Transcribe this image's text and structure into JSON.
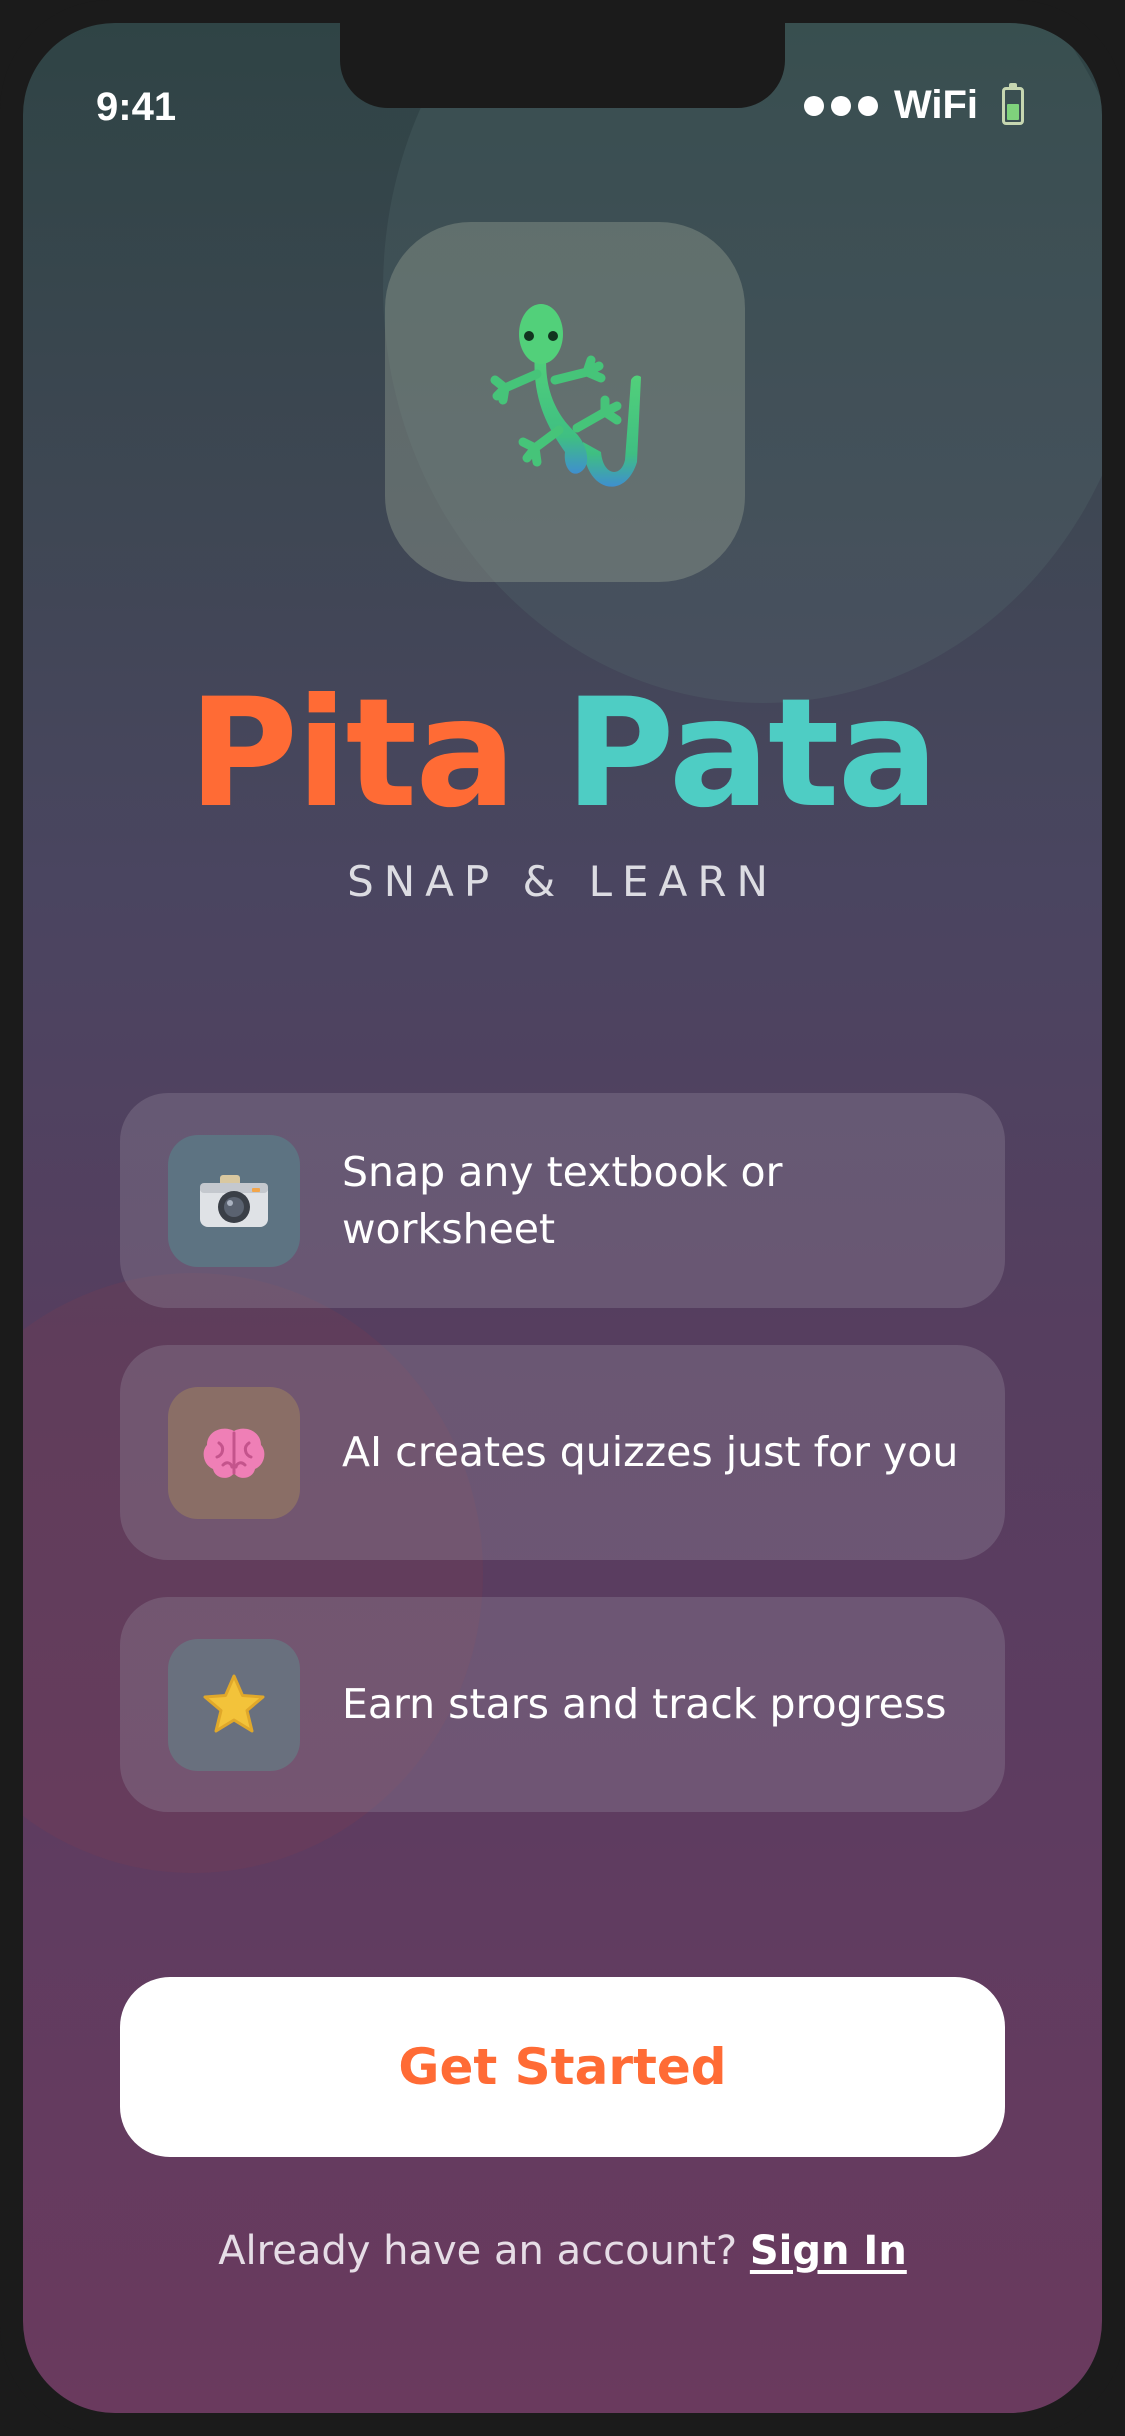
{
  "status_bar": {
    "time": "9:41",
    "network_label": "WiFi",
    "icons": [
      "signal-dots-icon",
      "battery-icon"
    ]
  },
  "app": {
    "logo_icon": "gecko-icon",
    "title_part1": "Pita",
    "title_part2": "Pata",
    "tagline": "SNAP & LEARN"
  },
  "features": [
    {
      "icon": "camera-icon",
      "text": "Snap any textbook or worksheet"
    },
    {
      "icon": "brain-icon",
      "text": "AI creates quizzes just for you"
    },
    {
      "icon": "star-icon",
      "text": "Earn stars and track progress"
    }
  ],
  "cta": {
    "primary_label": "Get Started",
    "signin_prompt": "Already have an account?",
    "signin_link": "Sign In"
  },
  "colors": {
    "title_orange": "#ff6b35",
    "title_teal": "#4ecdc4",
    "camera_tile": "#5d7382",
    "brain_tile": "#8a6e66",
    "star_tile": "#69707e"
  }
}
